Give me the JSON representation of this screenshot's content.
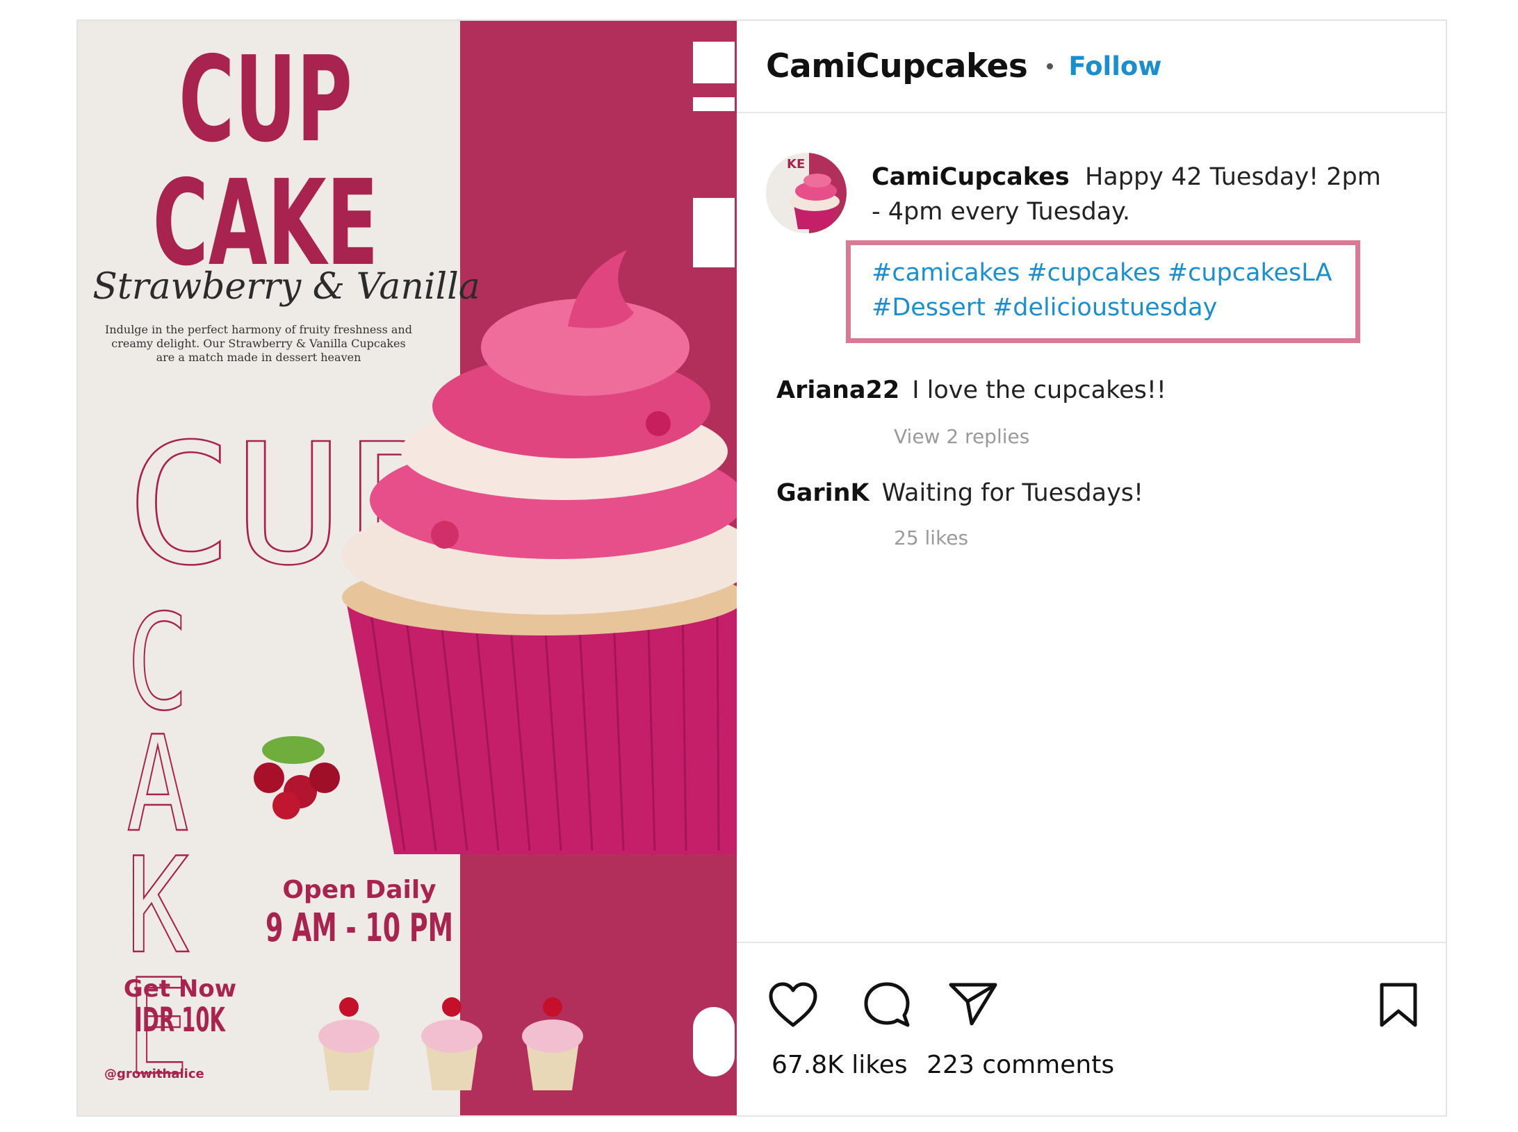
{
  "poster": {
    "title_line1": "CUP",
    "title_line2": "CAKE",
    "flavor": "Strawberry & Vanilla",
    "description": [
      "Indulge in the perfect harmony of fruity freshness and",
      "creamy delight. Our Strawberry & Vanilla Cupcakes",
      "are a match made in dessert heaven"
    ],
    "outline_word_top": "CUP",
    "outline_word_side": "CAKE",
    "open_label": "Open Daily",
    "hours": "9 AM - 10 PM",
    "get_now": "Get Now",
    "price": "IDR 10K",
    "handle": "@growithalice",
    "colors": {
      "primary": "#a8234f",
      "band": "#b22f5b",
      "background": "#eeebe7"
    }
  },
  "header": {
    "username": "CamiCupcakes",
    "follow_label": "Follow"
  },
  "caption": {
    "username": "CamiCupcakes",
    "text": "Happy 42 Tuesday! 2pm - 4pm every Tuesday.",
    "hashtags": [
      "#camicakes",
      "#cupcakes",
      "#cupcakesLA",
      "#Dessert",
      "#delicioustuesday"
    ]
  },
  "comments": [
    {
      "username": "Ariana22",
      "text": "I love the cupcakes!!",
      "meta": "View 2 replies"
    },
    {
      "username": "GarinK",
      "text": "Waiting for Tuesdays!",
      "meta": "25 likes"
    }
  ],
  "actions": {
    "icons": [
      "heart-icon",
      "comment-icon",
      "share-icon",
      "bookmark-icon"
    ],
    "likes": "67.8K likes",
    "comments": "223 comments"
  },
  "colors": {
    "link": "#1a8fd0",
    "highlight_box": "#d97a95"
  }
}
